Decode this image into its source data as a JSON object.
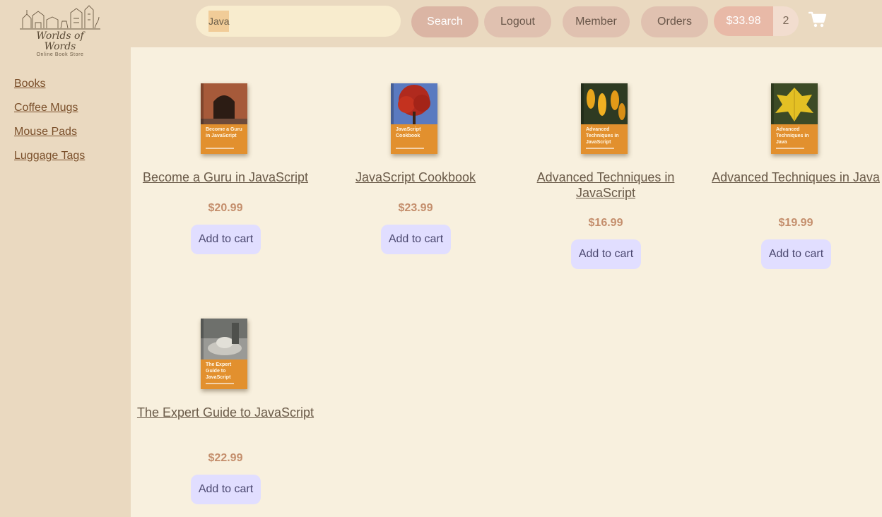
{
  "brand": {
    "logo_line1": "Worlds of",
    "logo_line2": "Words",
    "logo_sub": "Online Book Store"
  },
  "sidebar": {
    "categories": [
      {
        "label": "Books"
      },
      {
        "label": "Coffee Mugs"
      },
      {
        "label": "Mouse Pads"
      },
      {
        "label": "Luggage Tags"
      }
    ]
  },
  "header": {
    "search_value": "Java",
    "search_label": "Search",
    "logout_label": "Logout",
    "member_label": "Member",
    "orders_label": "Orders",
    "cart_total": "$33.98",
    "cart_count": "2",
    "cart_icon": "shopping-cart-icon"
  },
  "products": [
    {
      "title": "Become a Guru in JavaScript",
      "price": "$20.99",
      "add_label": "Add to cart",
      "cover_text": "Become a Guru in JavaScript"
    },
    {
      "title": "JavaScript Cookbook",
      "price": "$23.99",
      "add_label": "Add to cart",
      "cover_text": "JavaScript Cookbook"
    },
    {
      "title": "Advanced Techniques in JavaScript",
      "price": "$16.99",
      "add_label": "Add to cart",
      "cover_text": "Advanced Techniques in JavaScript"
    },
    {
      "title": "Advanced Techniques in Java",
      "price": "$19.99",
      "add_label": "Add to cart",
      "cover_text": "Advanced Techniques in Java"
    },
    {
      "title": "The Expert Guide to JavaScript",
      "price": "$22.99",
      "add_label": "Add to cart",
      "cover_text": "The Expert Guide to JavaScript"
    }
  ],
  "colors": {
    "page_bg": "#f8f0de",
    "sidebar_bg": "#ead9c0",
    "link": "#7a4f2a",
    "price": "#c48e6c",
    "add_button": "#e1deff",
    "cover_band": "#e2902e"
  }
}
